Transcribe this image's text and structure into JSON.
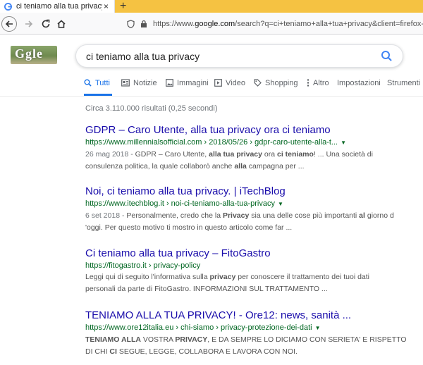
{
  "browser": {
    "tab_title": "ci teniamo alla tua privacy - Ce",
    "tab_close": "×",
    "new_tab": "+",
    "url_prefix": "https://www.",
    "url_domain": "google.com",
    "url_rest": "/search?q=ci+teniamo+alla+tua+privacy&client=firefox-b-d"
  },
  "search": {
    "logo_text": "Ggle",
    "query": "ci teniamo alla tua privacy"
  },
  "tabs": [
    {
      "label": "Tutti",
      "icon": "search-icon",
      "active": true
    },
    {
      "label": "Notizie",
      "icon": "news-icon"
    },
    {
      "label": "Immagini",
      "icon": "image-icon"
    },
    {
      "label": "Video",
      "icon": "video-icon"
    },
    {
      "label": "Shopping",
      "icon": "tag-icon"
    },
    {
      "label": "Altro",
      "icon": "more-vert-icon"
    },
    {
      "label": "Impostazioni"
    },
    {
      "label": "Strumenti"
    }
  ],
  "stats": "Circa 3.110.000 risultati (0,25 secondi)",
  "results": [
    {
      "title": "GDPR – Caro Utente, alla tua privacy ora ci teniamo",
      "url": "https://www.millennialsofficial.com › 2018/05/26 › gdpr-caro-utente-alla-t...",
      "date": "26 mag 2018 - ",
      "line1_parts": [
        "GDPR – Caro Utente, ",
        "alla tua privacy",
        " ora ",
        "ci teniamo",
        "! ... Una società di"
      ],
      "line2_parts": [
        "consulenza politica, la quale collaborò anche ",
        "alla",
        " campagna per ..."
      ]
    },
    {
      "title": "Noi, ci teniamo alla tua privacy. | iTechBlog",
      "url": "https://www.itechblog.it › noi-ci-teniamo-alla-tua-privacy",
      "date": "6 set 2018 - ",
      "line1_parts": [
        "Personalmente, credo che la ",
        "Privacy",
        " sia una delle cose più importanti ",
        "al",
        " giorno d"
      ],
      "line2_parts": [
        "'oggi. Per questo motivo ti mostro in questo articolo come far ..."
      ]
    },
    {
      "title": "Ci teniamo alla tua privacy – FitoGastro",
      "url": "https://fitogastro.it › privacy-policy",
      "date": "",
      "line1_parts": [
        "Leggi qui di seguito l'informativa sulla ",
        "privacy",
        " per conoscere il trattamento dei tuoi dati"
      ],
      "line2_parts": [
        "personali da parte di FitoGastro. INFORMAZIONI SUL TRATTAMENTO ..."
      ]
    },
    {
      "title": "TENIAMO ALLA TUA PRIVACY! - Ore12: news, sanità ...",
      "url": "https://www.ore12italia.eu › chi-siamo › privacy-protezione-dei-dati",
      "date": "",
      "line1_parts": [
        "TENIAMO ALLA",
        " VOSTRA ",
        "PRIVACY",
        ", E DA SEMPRE LO DICIAMO CON SERIETA' E RISPETTO"
      ],
      "line2_parts": [
        "DI CHI ",
        "CI",
        " SEGUE, LEGGE, COLLABORA E LAVORA CON NOI."
      ]
    }
  ],
  "colors": {
    "link": "#1a0dab",
    "url": "#006621",
    "accent": "#1a73e8",
    "tabstrip": "#f5c242"
  }
}
